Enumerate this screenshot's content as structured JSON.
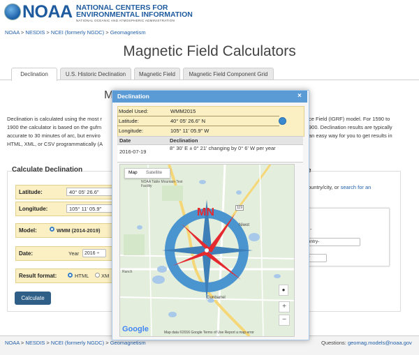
{
  "header": {
    "logo_text": "NOAA",
    "org_line1": "NATIONAL CENTERS FOR",
    "org_line2": "ENVIRONMENTAL INFORMATION",
    "org_line3": "NATIONAL OCEANIC AND ATMOSPHERIC ADMINISTRATION"
  },
  "breadcrumb": [
    "NOAA",
    "NESDIS",
    "NCEI (formerly NGDC)",
    "Geomagnetism"
  ],
  "breadcrumb_sep": " > ",
  "page_title": "Magnetic Field Calculators",
  "tabs": [
    "Declination",
    "U.S. Historic Declination",
    "Magnetic Field",
    "Magnetic Field Component Grid"
  ],
  "background_text": {
    "line1_left": "Declination is calculated using the most r",
    "line1_right": "ce Field (IGRF) model. For 1590 to",
    "line2_left": "1900 the calculator is based on the gufm",
    "line2_right": "900. Declination results are typically",
    "line3_left": "accurate to 30 minutes of arc, but enviro",
    "line3_right": "an easy way for you to get results in",
    "line4_left": "HTML, XML, or CSV programmatically (A",
    "peek_heading": "M",
    "right_link_prefix": "ountry/city, or",
    "right_link": "search for an",
    "right_letter": "e",
    "right_dash": "-",
    "right_select1": "ountry-",
    "right_select2": "ity"
  },
  "calc_form": {
    "title": "Calculate Declination",
    "latitude_label": "Latitude:",
    "latitude_value": "40° 05' 26.6\"",
    "longitude_label": "Longitude:",
    "longitude_value": "105° 11' 05.9\"",
    "model_label": "Model:",
    "model_value": "WMM (2014-2019)",
    "date_label": "Date:",
    "year_label": "Year",
    "year_value": "2016 ÷",
    "format_label": "Result format:",
    "format_html": "HTML",
    "format_xml": "XM",
    "calculate_button": "Calculate"
  },
  "dialog": {
    "title": "Declination",
    "close": "×",
    "model_used_label": "Model Used:",
    "model_used_value": "WMM2015",
    "latitude_label": "Latitude:",
    "latitude_value": "40° 05' 26.6\" N",
    "longitude_label": "Longitude:",
    "longitude_value": "105° 11' 05.9\" W",
    "table_headers": [
      "Date",
      "Declination"
    ],
    "table_rows": [
      {
        "date": "2016-07-19",
        "declination": "8° 30' E  ± 0° 21'  changing by  0° 6' W per year"
      }
    ]
  },
  "map": {
    "type_active": "Map",
    "type_other": "Satellite",
    "label_facility": "NOAA Table Mountain Test Facility",
    "label_niwot": "Niwot",
    "label_gunbarrel": "Gunbarrel",
    "label_ranch": "Ranch",
    "label_road": "119",
    "compass_label": "MN",
    "attribution": "Map data ©2016 Google   Terms of Use   Report a map error",
    "google": "Google",
    "zoom_in": "+",
    "zoom_out": "−"
  },
  "footer": {
    "breadcrumb": [
      "NOAA",
      "NESDIS",
      "NCEI (formerly NGDC)",
      "Geomagnetism"
    ],
    "questions_label": "Questions:",
    "questions_email": "geomag.models@noaa.gov"
  },
  "colors": {
    "noaa_blue": "#1d5a9e",
    "link_blue": "#1f5ea8",
    "dialog_titlebar": "#5b9bd5",
    "result_highlight": "#fbf0c4",
    "compass_blue": "#4a94cf",
    "compass_red": "#e52a2f",
    "button_blue": "#2f5f87"
  }
}
